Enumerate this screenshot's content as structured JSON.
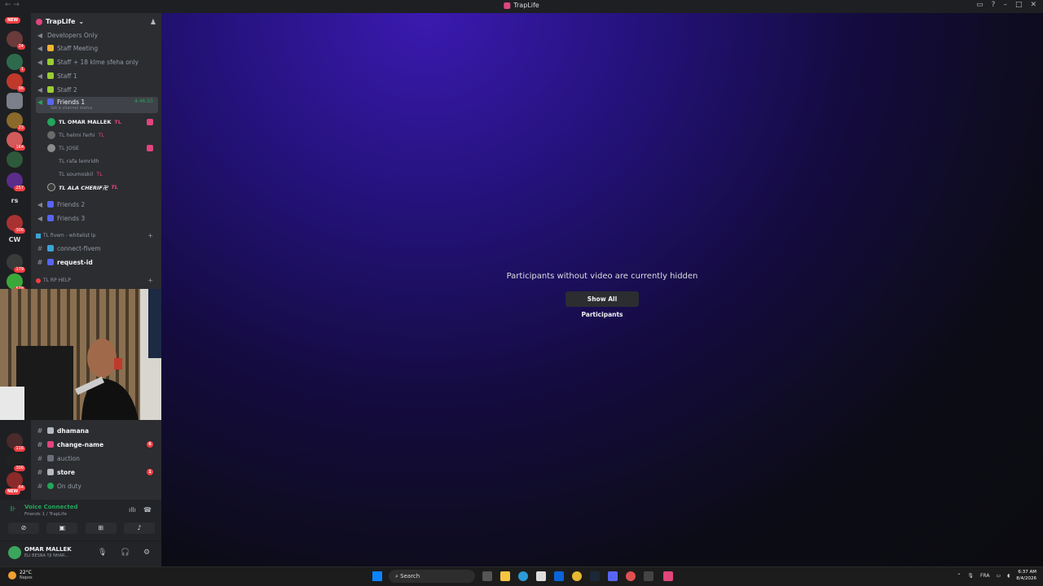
{
  "titlebar": {
    "title": "TrapLife",
    "back": "←",
    "forward": "→"
  },
  "rail": {
    "new_label_top": "NEW",
    "new_label_bottom": "NEW",
    "badges": [
      "24",
      "1",
      "96",
      "23",
      "164",
      "257",
      "306",
      "179",
      "578",
      "116",
      "306",
      "64"
    ],
    "text_servers": [
      "rs",
      "CW"
    ]
  },
  "server": {
    "name": "TrapLife",
    "chevron": "⌄"
  },
  "channels": {
    "developers_only": "Developers Only",
    "staff_meeting": "Staff Meeting",
    "staff_18": "Staff + 18 klme sfeha only",
    "staff1": "Staff 1",
    "staff2": "Staff 2",
    "friends1": "Friends 1",
    "friends1_timer": "4:46:53",
    "friends1_status": "Set a channel status",
    "friends2": "Friends 2",
    "friends3": "Friends 3",
    "cat_fivem": "TL fivem - whitelist lp",
    "connect_fivem": "connect-fivem",
    "request_id": "request-id",
    "cat_help": "TL RP HELP",
    "dhamana": "dhamana",
    "change_name": "change-name",
    "change_name_badge": "6",
    "auction": "auction",
    "store": "store",
    "store_badge": "1",
    "on_duty": "On duty"
  },
  "members": [
    {
      "name": "TL  OMAR MALLEK",
      "tag": "TL",
      "bold": true
    },
    {
      "name": "TL  helmi ferhi",
      "tag": "TL",
      "bold": false
    },
    {
      "name": "TL  JOSE",
      "tag": "",
      "bold": false
    },
    {
      "name": "TL  rafa lemridh",
      "tag": "",
      "bold": false
    },
    {
      "name": "TL  soumoskil",
      "tag": "TL",
      "bold": false
    },
    {
      "name": "TL  ALA CHERIF卍",
      "tag": "TL",
      "bold": true
    }
  ],
  "voice": {
    "title": "Voice Connected",
    "subtitle": "Friends 1 / TrapLife"
  },
  "user": {
    "name": "OMAR MALLEK",
    "status": "ELI BESNA YJI NHAR..."
  },
  "stage": {
    "hidden_message": "Participants without video are currently hidden",
    "show_all_label": "Show All Participants"
  },
  "taskbar": {
    "temperature": "22°C",
    "condition": "Napos",
    "search_placeholder": "Search",
    "language": "FRA",
    "time": "6:37 AM",
    "date": "8/4/2026"
  },
  "colors": {
    "accent_green": "#23a55a",
    "brand_pink": "#e0457b",
    "stage_purple": "#3a1ab0"
  }
}
